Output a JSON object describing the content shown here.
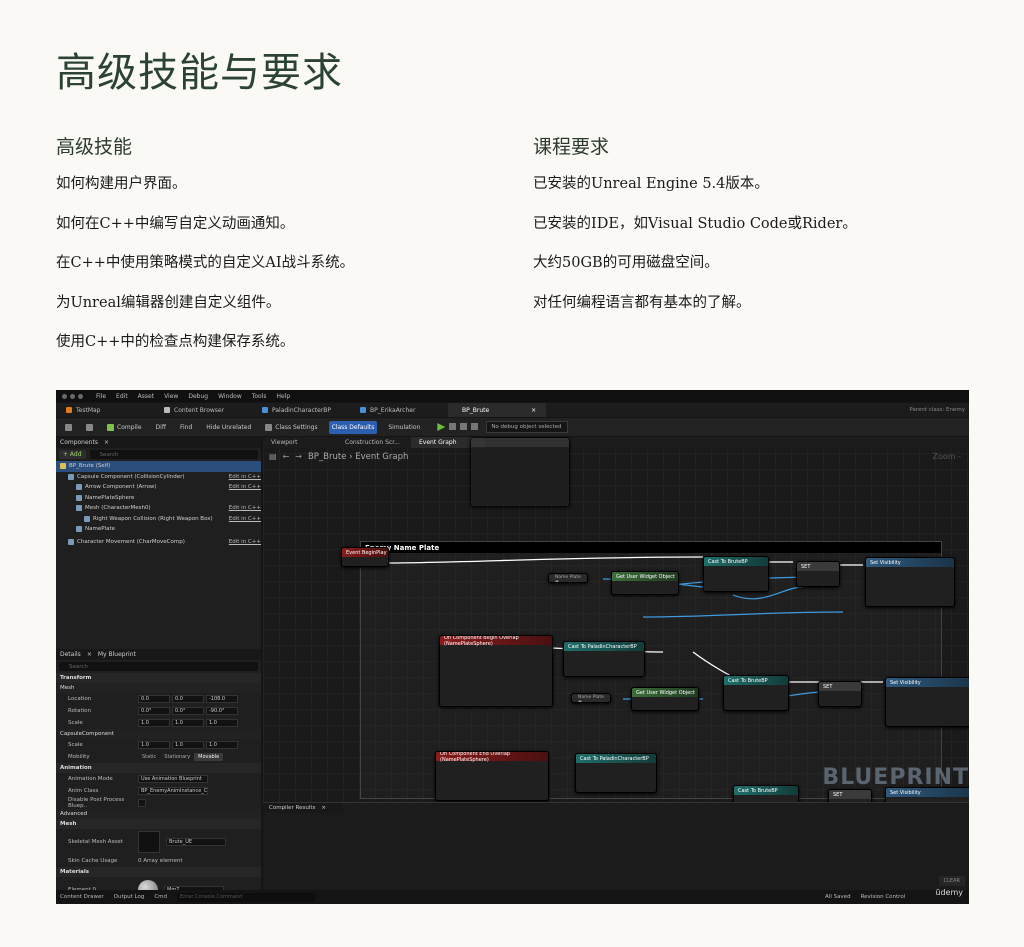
{
  "page_title": "高级技能与要求",
  "left_col": {
    "heading": "高级技能",
    "items": [
      "如何构建用户界面。",
      "如何在C++中编写自定义动画通知。",
      "在C++中使用策略模式的自定义AI战斗系统。",
      "为Unreal编辑器创建自定义组件。",
      "使用C++中的检查点构建保存系统。"
    ]
  },
  "right_col": {
    "heading": "课程要求",
    "items": [
      "已安装的Unreal Engine 5.4版本。",
      "已安装的IDE，如Visual Studio Code或Rider。",
      "大约50GB的可用磁盘空间。",
      "对任何编程语言都有基本的了解。"
    ]
  },
  "editor": {
    "menu": [
      "File",
      "Edit",
      "Asset",
      "View",
      "Debug",
      "Window",
      "Tools",
      "Help"
    ],
    "tabs": [
      "TestMap",
      "Content Browser",
      "PaladinCharacterBP",
      "BP_ErikaArcher",
      "BP_Brute"
    ],
    "parent_class": "Parent class: Enemy",
    "toolbar": {
      "compile": "Compile",
      "diff": "Diff",
      "find": "Find",
      "hide_unrelated": "Hide Unrelated",
      "class_settings": "Class Settings",
      "class_defaults": "Class Defaults",
      "simulation": "Simulation",
      "debug_select": "No debug object selected"
    },
    "components": {
      "title": "Components",
      "add": "+ Add",
      "search": "Search",
      "items": [
        {
          "name": "BP_Brute (Self)",
          "edit": ""
        },
        {
          "name": "Capsule Component (CollisionCylinder)",
          "edit": "Edit in C++"
        },
        {
          "name": "Arrow Component (Arrow)",
          "edit": "Edit in C++"
        },
        {
          "name": "NamePlateSphere",
          "edit": ""
        },
        {
          "name": "Mesh (CharacterMesh0)",
          "edit": "Edit in C++"
        },
        {
          "name": "Right Weapon Collision (Right Weapon Box)",
          "edit": "Edit in C++"
        },
        {
          "name": "NamePlate",
          "edit": ""
        },
        {
          "name": "Character Movement (CharMoveComp)",
          "edit": "Edit in C++"
        }
      ]
    },
    "details": {
      "title": "Details",
      "my_blueprint": "My Blueprint",
      "search": "Search",
      "transform": "Transform",
      "mesh": "Mesh",
      "location": "Location",
      "location_vals": [
        "0.0",
        "0.0",
        "-108.0"
      ],
      "rotation": "Rotation",
      "rotation_vals": [
        "0.0°",
        "0.0°",
        "-90.0°"
      ],
      "scale": "Scale",
      "scale_vals": [
        "1.0",
        "1.0",
        "1.0"
      ],
      "capsule": "CapsuleComponent",
      "mobility": "Mobility",
      "mobility_opts": [
        "Static",
        "Stationary",
        "Movable"
      ],
      "animation": "Animation",
      "anim_mode": "Animation Mode",
      "anim_mode_val": "Use Animation Blueprint",
      "anim_class": "Anim Class",
      "anim_class_val": "BP_EnemyAnimInstance_C",
      "disable_pp": "Disable Post Process Bluep..",
      "advanced": "Advanced",
      "mesh2": "Mesh",
      "skel_mesh": "Skeletal Mesh Asset",
      "skel_mesh_val": "Brute_UE",
      "skin_cache": "Skin Cache Usage",
      "skin_cache_val": "0 Array element",
      "materials": "Materials",
      "element0": "Element 0",
      "element0_val": "Mm7"
    },
    "graph": {
      "tabs": [
        "Viewport",
        "Construction Scr...",
        "Event Graph"
      ],
      "breadcrumb": "BP_Brute › Event Graph",
      "zoom": "Zoom -",
      "comment": "Enemy Name Plate",
      "nodes": {
        "begin_play": "Event BeginPlay",
        "cast1": "Cast To BruteBP",
        "set1": "SET",
        "setvis1": "Set Visibility",
        "getwidget1": "Get User Widget Object",
        "overlap_begin": "On Component Begin Overlap (NamePlateSphere)",
        "cast2": "Cast To PaladinCharacterBP",
        "cast3": "Cast To BruteBP",
        "set2": "SET",
        "setvis2": "Set Visibility",
        "getwidget2": "Get User Widget Object",
        "overlap_end": "On Component End Overlap (NamePlateSphere)",
        "cast4": "Cast To PaladinCharacterBP",
        "cast5": "Cast To BruteBP",
        "set3": "SET",
        "setvis3": "Set Visibility"
      },
      "watermark": "BLUEPRINT"
    },
    "compiler": {
      "title": "Compiler Results",
      "clear": "CLEAR"
    },
    "status": {
      "drawer": "Content Drawer",
      "output": "Output Log",
      "cmd": "Cmd",
      "cmd_placeholder": "Enter Console Command",
      "saved": "All Saved",
      "revision": "Revision Control"
    },
    "udemy": "ūdemy"
  }
}
